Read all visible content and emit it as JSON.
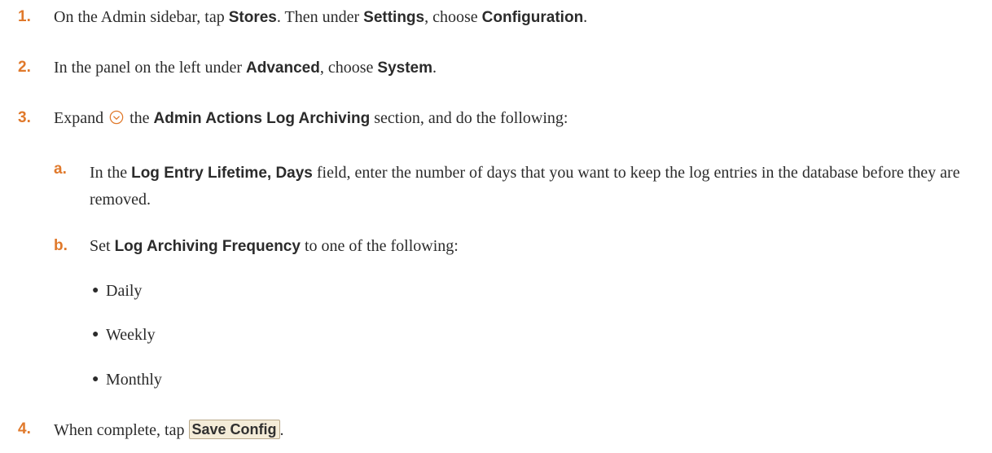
{
  "steps": [
    {
      "num": "1.",
      "t1": "On the Admin sidebar, tap ",
      "b1": "Stores",
      "t2": ". Then under  ",
      "b2": "Settings",
      "t3": ", choose ",
      "b3": "Configuration",
      "t4": "."
    },
    {
      "num": "2.",
      "t1": "In the panel on the left under ",
      "b1": "Advanced",
      "t2": ", choose ",
      "b2": "System",
      "t3": "."
    },
    {
      "num": "3.",
      "t1": "Expand",
      "t2": "the ",
      "b1": "Admin Actions Log Archiving",
      "t3": " section, and do the following:",
      "icon": "chevron-down-circle-icon"
    },
    {
      "num": "4.",
      "t1": "When complete, tap ",
      "button": "Save Config",
      "t2": "."
    }
  ],
  "substeps": [
    {
      "letter": "a.",
      "t1": "In the ",
      "b1": "Log Entry Lifetime, Days",
      "t2": " field, enter the number of days that you want to keep the log entries in the database before they are removed."
    },
    {
      "letter": "b.",
      "t1": "Set ",
      "b1": "Log Archiving Frequency",
      "t2": " to one of the following:"
    }
  ],
  "frequency_options": [
    "Daily",
    "Weekly",
    "Monthly"
  ],
  "colors": {
    "step_number": "#e0792b",
    "text": "#2b2b2b",
    "button_bg": "#f4ecd8",
    "icon": "#e0792b"
  }
}
